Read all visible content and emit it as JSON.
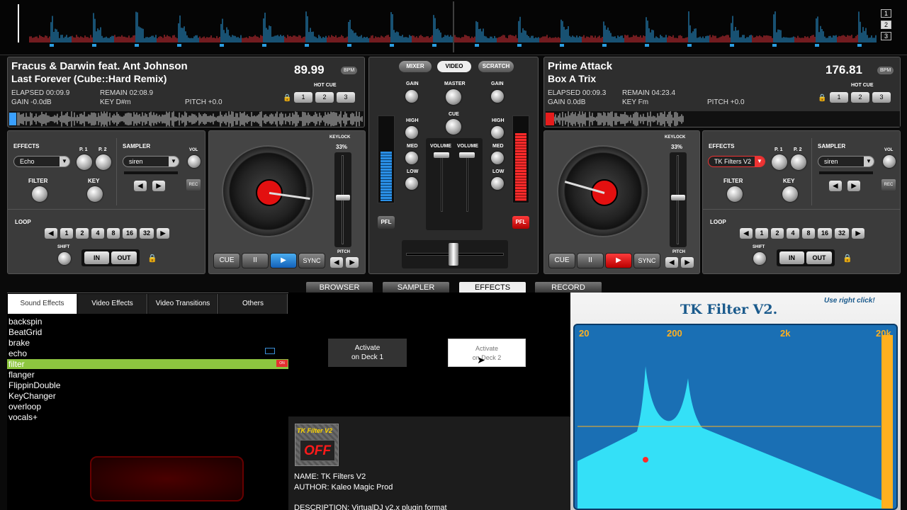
{
  "layers": [
    "1",
    "2",
    "3"
  ],
  "deck1": {
    "artist": "Fracus & Darwin feat. Ant Johnson",
    "title": "Last Forever (Cube::Hard Remix)",
    "bpm": "89.99",
    "bpm_label": "BPM",
    "elapsed": "ELAPSED 00:09.9",
    "remain": "REMAIN 02:08.9",
    "gain": "GAIN -0.0dB",
    "key": "KEY D#m",
    "pitch": "PITCH +0.0",
    "hotcue_label": "HOT CUE",
    "hotcues": [
      "1",
      "2",
      "3"
    ],
    "effects_label": "EFFECTS",
    "effect": "Echo",
    "p1": "P. 1",
    "p2": "P. 2",
    "sampler_label": "SAMPLER",
    "sample": "siren",
    "vol": "VOL",
    "rec": "REC",
    "filter": "FILTER",
    "key_label": "KEY",
    "loop": "LOOP",
    "loop_sizes": [
      "1",
      "2",
      "4",
      "8",
      "16",
      "32"
    ],
    "shift": "SHIFT",
    "in": "IN",
    "out": "OUT",
    "keylock": "KEYLOCK",
    "pitch_range": "33%",
    "pitch_label": "PITCH",
    "cue": "CUE",
    "pause": "II",
    "play": "▶",
    "sync": "SYNC"
  },
  "deck2": {
    "artist": "Prime Attack",
    "title": "Box A Trix",
    "bpm": "176.81",
    "bpm_label": "BPM",
    "elapsed": "ELAPSED 00:09.3",
    "remain": "REMAIN 04:23.4",
    "gain": "GAIN 0.0dB",
    "key": "KEY Fm",
    "pitch": "PITCH +0.0",
    "hotcue_label": "HOT CUE",
    "hotcues": [
      "1",
      "2",
      "3"
    ],
    "effects_label": "EFFECTS",
    "effect": "TK Filters V2",
    "p1": "P. 1",
    "p2": "P. 2",
    "sampler_label": "SAMPLER",
    "sample": "siren",
    "vol": "VOL",
    "rec": "REC",
    "filter": "FILTER",
    "key_label": "KEY",
    "loop": "LOOP",
    "loop_sizes": [
      "1",
      "2",
      "4",
      "8",
      "16",
      "32"
    ],
    "shift": "SHIFT",
    "in": "IN",
    "out": "OUT",
    "keylock": "KEYLOCK",
    "pitch_range": "33%",
    "pitch_label": "PITCH",
    "cue": "CUE",
    "pause": "II",
    "play": "▶",
    "sync": "SYNC"
  },
  "mixer": {
    "tabs": [
      "MIXER",
      "VIDEO",
      "SCRATCH"
    ],
    "gain": "GAIN",
    "master": "MASTER",
    "cue": "CUE",
    "high": "HIGH",
    "med": "MED",
    "low": "LOW",
    "volume": "VOLUME",
    "pfl": "PFL"
  },
  "nav_tabs": [
    "BROWSER",
    "SAMPLER",
    "EFFECTS",
    "RECORD"
  ],
  "effect_tabs": [
    "Sound Effects",
    "Video Effects",
    "Video Transitions",
    "Others"
  ],
  "effects_list": [
    "backspin",
    "BeatGrid",
    "brake",
    "echo",
    "filter",
    "flanger",
    "FlippinDouble",
    "KeyChanger",
    "overloop",
    "vocals+"
  ],
  "selected_effect_badge": "ON",
  "activate1": "Activate\non Deck 1",
  "activate2": "Activate\non Deck 2",
  "plugin": {
    "thumb_title": "TK Filter V2",
    "thumb_state": "OFF",
    "name": "NAME: TK Filters V2",
    "author": "AUTHOR: Kaleo Magic Prod",
    "description": "DESCRIPTION: VirtualDJ v2.x plugin format"
  },
  "tk": {
    "title": "TK Filter  V2.",
    "hint": "Use right click!",
    "freqs": [
      "20",
      "200",
      "2k",
      "20k"
    ]
  }
}
